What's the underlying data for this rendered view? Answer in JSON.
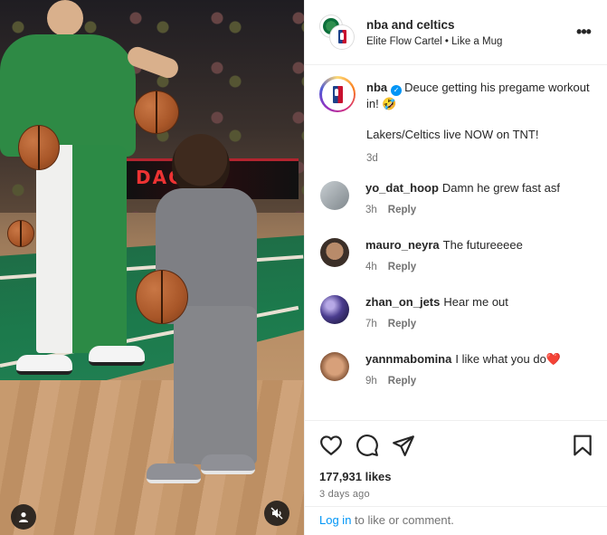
{
  "header": {
    "title": "nba and celtics",
    "subtitle": "Elite Flow Cartel • Like a Mug",
    "more_label": "•••"
  },
  "media": {
    "scoreboard_text": "DACC"
  },
  "caption": {
    "username": "nba",
    "text": "Deuce getting his pregame workout in! 🤣",
    "line2": "Lakers/Celtics live NOW on TNT!",
    "time": "3d"
  },
  "comments": [
    {
      "username": "yo_dat_hoop",
      "text": "Damn he grew fast asf",
      "time": "3h",
      "reply": "Reply",
      "avatar_color": "#9aa3a8"
    },
    {
      "username": "mauro_neyra",
      "text": "The futureeeee",
      "time": "4h",
      "reply": "Reply",
      "avatar_color": "#5b4a3e"
    },
    {
      "username": "zhan_on_jets",
      "text": "Hear me out",
      "time": "7h",
      "reply": "Reply",
      "avatar_color": "#3b2f66"
    },
    {
      "username": "yannmabomina",
      "text": "I like what you do",
      "heart": "❤️",
      "time": "9h",
      "reply": "Reply",
      "avatar_color": "#b07a5a"
    }
  ],
  "footer": {
    "likes": "177,931 likes",
    "ago": "3 days ago",
    "login_link": "Log in",
    "login_rest": " to like or comment."
  },
  "icons": {
    "like": "heart-icon",
    "comment": "comment-icon",
    "share": "send-icon",
    "save": "bookmark-icon",
    "verified": "verified-badge-icon",
    "user": "user-tag-icon",
    "mute": "mute-icon"
  },
  "colors": {
    "link": "#0095f6",
    "verified": "#0095f6",
    "muted_text": "#737373",
    "text": "#262626"
  }
}
